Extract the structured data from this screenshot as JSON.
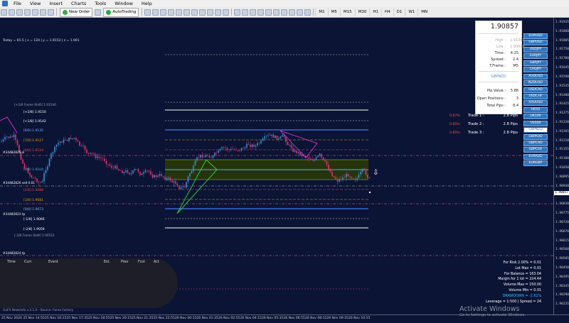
{
  "menu": [
    "File",
    "View",
    "Insert",
    "Charts",
    "Tools",
    "Window",
    "Help"
  ],
  "toolbar": {
    "new_order": "New Order",
    "autotrading": "AutoTrading",
    "timeframes": [
      "M1",
      "M5",
      "M15",
      "M30",
      "H1",
      "H4",
      "D1",
      "W1",
      "MN"
    ]
  },
  "chart_header": "Today = 65.5  |  x = 124  |  y = 1.9153  |  z = 1.901",
  "panel": {
    "price": "1.90857",
    "rows": [
      {
        "k": "High :",
        "v": "1.91345"
      },
      {
        "k": "Low :",
        "v": "1.90608"
      },
      {
        "k": "Time :",
        "v": "4:25"
      },
      {
        "k": "Spread :",
        "v": "2.4"
      },
      {
        "k": "T.Frame :",
        "v": "M5"
      }
    ],
    "symbol": "GBPNZD",
    "rows2": [
      {
        "k": "Pip Value :",
        "v": "5.88"
      },
      {
        "k": "Open Positions :",
        "v": "3"
      },
      {
        "k": "Total Pips :",
        "v": "8.4"
      }
    ]
  },
  "symbols": [
    "EURUSD",
    "GBPUSD",
    "USDJPY",
    "EURJPY",
    "GBPJPY",
    "CADJPY",
    "AUDUSD",
    "NZDUSD",
    "USDCAD",
    "USDCHF",
    "XAUUSD",
    "HK50",
    "UK100",
    "US500",
    "GBPNZD",
    "GBPAUD",
    "GBPCAD",
    "GBPCHF",
    "EURAUD",
    "EURGBP"
  ],
  "selected_symbol": "GBPNZD",
  "trades": [
    {
      "pct": "0.67%",
      "label": "Trade 1 :",
      "pips": "2.8 Pips"
    },
    {
      "pct": "0.65%",
      "label": "Trade 2 :",
      "pips": "2.8 Pips"
    },
    {
      "pct": "0.65%",
      "label": "Trade 3 :",
      "pips": "2.8 Pips"
    }
  ],
  "risk": {
    "lines": [
      "For Risk 2.00% = 0.01",
      "Lot Max = 0.01",
      "For Balance = 163.04",
      "Margin for 1 lot = 224.44",
      "Volume Max = 150.00",
      "Volume Min = 0.01"
    ],
    "drawdown": "DRAWDOWN = -2.61%",
    "footer": "Leverage = 1:500 | Spread = 24"
  },
  "news": {
    "cols": [
      "Time",
      "Curr.",
      "Event",
      "Est.",
      "Prev",
      "Fcst",
      "Act"
    ]
  },
  "levels": [
    {
      "label": "[+2/8]  1.9150"
    },
    {
      "label": "[+1/8]  1.9142"
    },
    {
      "label": "[8/8]  1.9135"
    },
    {
      "label": "[7/8]  1.9127"
    },
    {
      "label": "[6/8]  1.9119"
    },
    {
      "label": "[4/8]  1.9104"
    },
    {
      "label": "[2/8]  1.9088"
    },
    {
      "label": "[1/8]  1.9081"
    },
    {
      "label": "[0/8]  1.9073"
    },
    {
      "label": "[-1/8]  1.9066"
    },
    {
      "label": "[-2/8]  1.9058"
    }
  ],
  "side_tags": [
    "#34482826 sl",
    "#34482826 sell 0.01",
    "#34482823 tp",
    "#34482824 tp"
  ],
  "frame_notes": [
    "[+2/8 Frame Shift]  1.91546",
    "[-2/8 Frame Shift]  1.90521"
  ],
  "price_axis": {
    "ticks": [
      "1.91915",
      "1.91860",
      "1.91805",
      "1.91750",
      "1.91700",
      "1.91645",
      "1.91590",
      "1.91535",
      "1.91480",
      "1.91425",
      "1.91375",
      "1.91320",
      "1.91265",
      "1.91210",
      "1.91155",
      "1.91100",
      "1.91050",
      "1.90995",
      "1.90940",
      "1.90885",
      "1.90830",
      "1.90775",
      "1.90720",
      "1.90670",
      "1.90615",
      "1.90560",
      "1.90505",
      "1.90450",
      "1.90395",
      "1.90345",
      "1.90290",
      "1.90235"
    ],
    "current": "1.90857"
  },
  "time_axis": [
    "25 Nov 2020",
    "25 Nov 14:55",
    "25 Nov 16:15",
    "25 Nov 17:35",
    "25 Nov 18:55",
    "25 Nov 20:15",
    "25 Nov 21:35",
    "25 Nov 22:55",
    "26 Nov 00:15",
    "26 Nov 01:35",
    "26 Nov 02:55",
    "26 Nov 04:15",
    "26 Nov 05:35",
    "26 Nov 06:55",
    "26 Nov 08:15",
    "26 Nov 09:35",
    "26 Nov 10:55"
  ],
  "watermark": {
    "title": "Activate Windows",
    "sub": "Go to Settings to activate Windows."
  },
  "footer_note": "GaFX NewsInfo v.2.1.0  -  Source: Forex Factory",
  "colors": {
    "bg": "#0b1434",
    "bull": "#3b8fd6",
    "bear": "#e0366f",
    "accent": "#2f76bf"
  }
}
